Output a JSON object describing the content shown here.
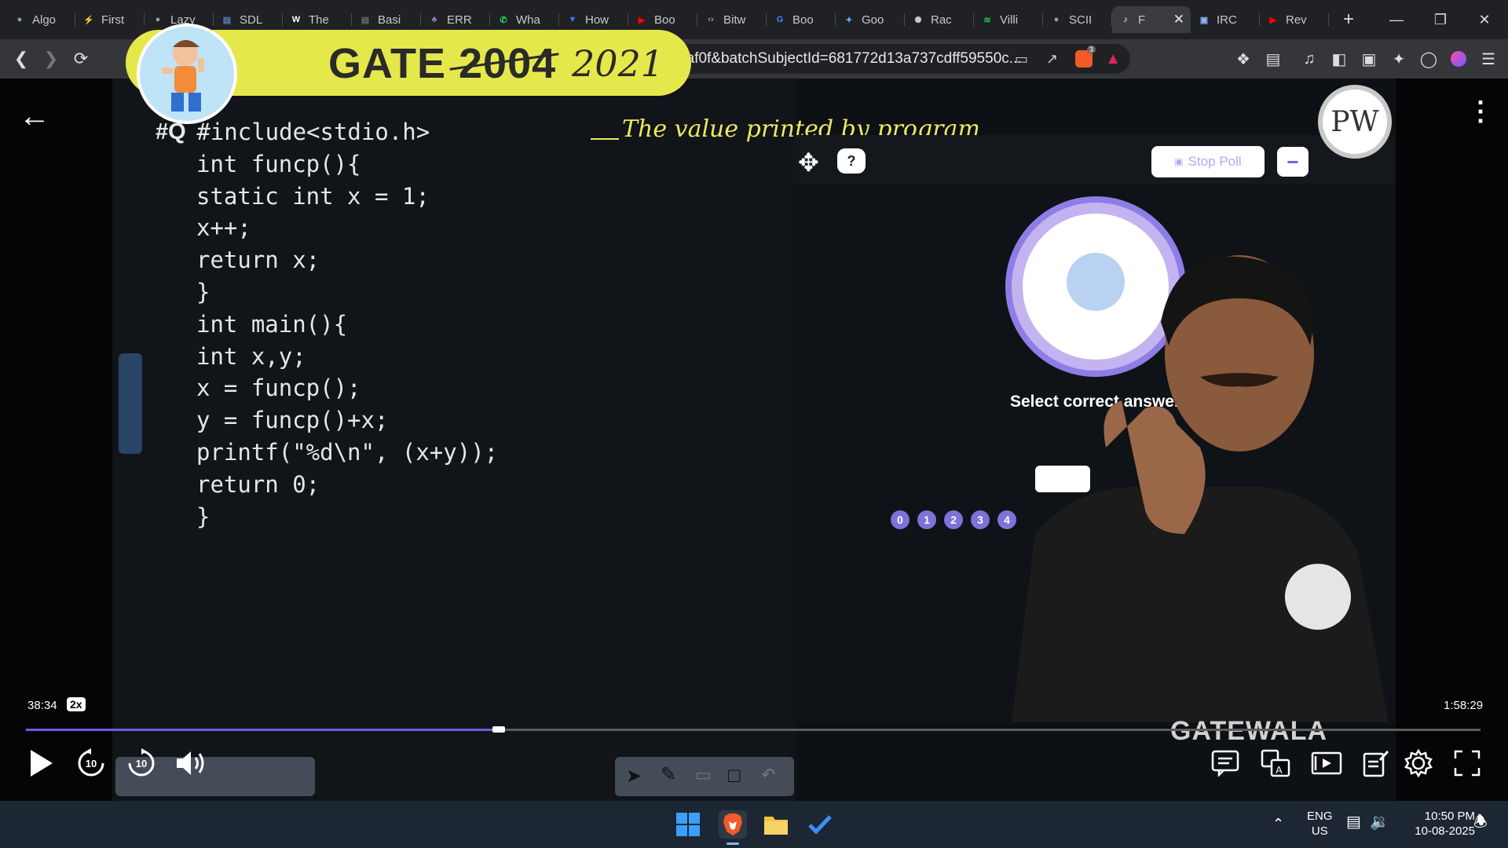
{
  "browser": {
    "tabs": [
      {
        "label": "Algo",
        "icon": "globe-icon",
        "color": "#8c9eb0"
      },
      {
        "label": "First",
        "icon": "lightning-icon",
        "color": "#f0a030"
      },
      {
        "label": "Lazy",
        "icon": "globe-icon",
        "color": "#9aa0a6"
      },
      {
        "label": "SDL",
        "icon": "doc-icon",
        "color": "#5a7fb0"
      },
      {
        "label": "The",
        "icon": "w3-icon",
        "color": "#ffffff"
      },
      {
        "label": "Basi",
        "icon": "doc-icon",
        "color": "#6a6a6a"
      },
      {
        "label": "ERR",
        "icon": "tree-icon",
        "color": "#a07ab8"
      },
      {
        "label": "Wha",
        "icon": "whatsapp-icon",
        "color": "#25d366"
      },
      {
        "label": "How",
        "icon": "bookmark-icon",
        "color": "#4a6cf0"
      },
      {
        "label": "Boo",
        "icon": "youtube-icon",
        "color": "#ff0000"
      },
      {
        "label": "Bitw",
        "icon": "code-icon",
        "color": "#9aa0a6"
      },
      {
        "label": "Boo",
        "icon": "google-icon",
        "color": "#4285f4"
      },
      {
        "label": "Goo",
        "icon": "gemini-icon",
        "color": "#6fa8ff"
      },
      {
        "label": "Rac",
        "icon": "openai-icon",
        "color": "#cfcfcf"
      },
      {
        "label": "Villi",
        "icon": "spotify-icon",
        "color": "#1db954"
      },
      {
        "label": "SCII",
        "icon": "globe-icon",
        "color": "#9aa0a6"
      },
      {
        "label": "F",
        "icon": "speaker-icon",
        "color": "#ffffff",
        "active": true
      },
      {
        "label": "IRC",
        "icon": "image-icon",
        "color": "#8ab4f8"
      },
      {
        "label": "Rev",
        "icon": "youtube-icon",
        "color": "#ff0000"
      }
    ],
    "url": "https://www.pw.live/watch/?batchSlug=6816e8e4df816c6bffffaf0f&batchSubjectId=681772d13a737cdff59550c...",
    "shield_badge": "3"
  },
  "lecture": {
    "banner_title": "GATE 2004",
    "banner_handwritten": "2021",
    "question_marker": "#Q",
    "code_lines": [
      "   #include<stdio.h>",
      "int funcp(){",
      "static int x = 1;",
      "x++;",
      "return x;",
      "}",
      "int main(){",
      "int x,y;",
      "x = funcp();",
      "y = funcp()+x;",
      "printf(\"%d\\n\", (x+y));",
      "return 0;",
      "}"
    ],
    "annotation": "The value printed by program",
    "watermark": "GATEWALA",
    "logo_text": "PW"
  },
  "poll": {
    "help": "?",
    "stop_label": "Stop Poll",
    "minus": "−",
    "prompt": "Select correct answer",
    "options": [
      "0",
      "1",
      "2",
      "3",
      "4"
    ]
  },
  "player": {
    "current_time": "38:34",
    "speed": "2x",
    "duration": "1:58:29",
    "progress_fraction": 0.325,
    "rewind_label": "10",
    "forward_label": "10"
  },
  "taskbar": {
    "lang": "ENG",
    "region": "US",
    "time": "10:50 PM",
    "date": "10-08-2025"
  }
}
